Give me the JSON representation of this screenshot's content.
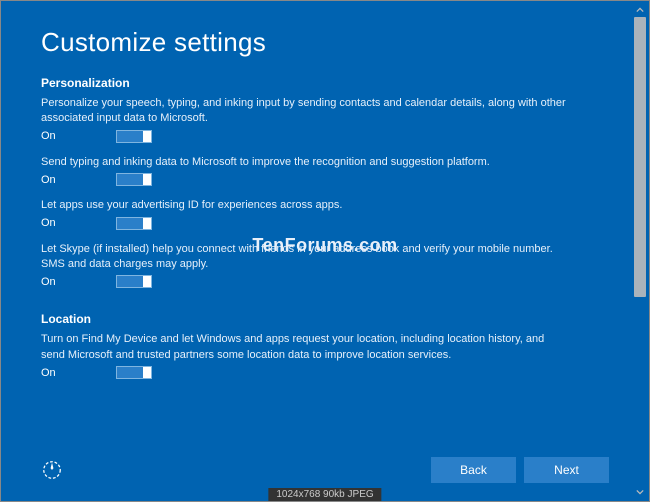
{
  "title": "Customize settings",
  "sections": {
    "personalization": {
      "header": "Personalization",
      "items": [
        {
          "desc": "Personalize your speech, typing, and inking input by sending contacts and calendar details, along with other associated input data to Microsoft.",
          "state": "On"
        },
        {
          "desc": "Send typing and inking data to Microsoft to improve the recognition and suggestion platform.",
          "state": "On"
        },
        {
          "desc": "Let apps use your advertising ID for experiences across apps.",
          "state": "On"
        },
        {
          "desc": "Let Skype (if installed) help you connect with friends in your address book and verify your mobile number. SMS and data charges may apply.",
          "state": "On"
        }
      ]
    },
    "location": {
      "header": "Location",
      "items": [
        {
          "desc": "Turn on Find My Device and let Windows and apps request your location, including location history, and send Microsoft and trusted partners some location data to improve location services.",
          "state": "On"
        }
      ]
    }
  },
  "watermark": "TenForums.com",
  "buttons": {
    "back": "Back",
    "next": "Next"
  },
  "meta": "1024x768   90kb   JPEG"
}
